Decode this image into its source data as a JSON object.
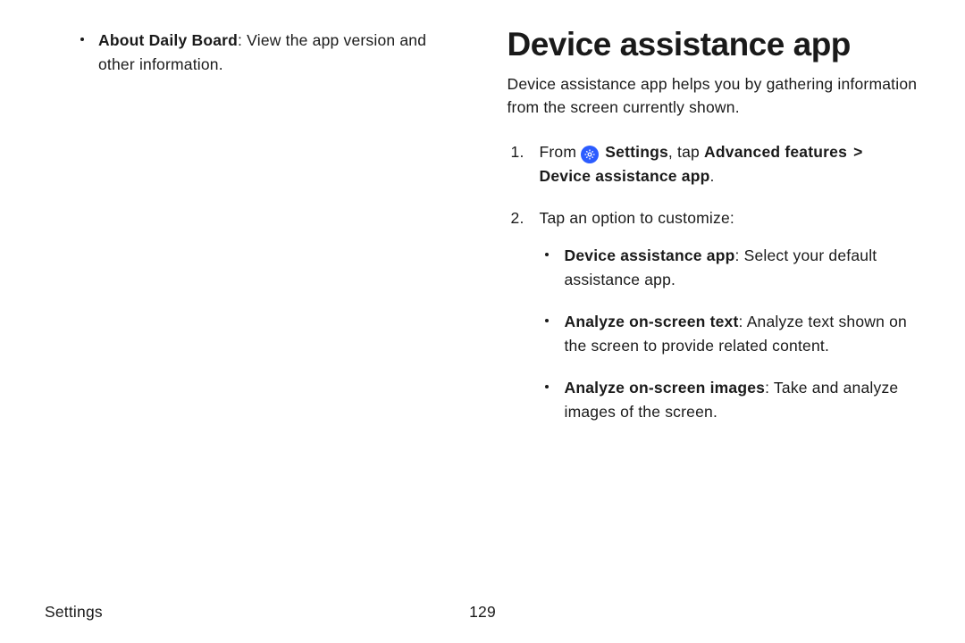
{
  "left": {
    "bullet_title": "About Daily Board",
    "bullet_body": ": View the app version and other information."
  },
  "right": {
    "heading": "Device assistance app",
    "intro": "Device assistance app helps you by gathering information from the screen currently shown.",
    "step1": {
      "from": "From ",
      "settings": "Settings",
      "tap_label": ", tap ",
      "adv": "Advanced features",
      "chev": " >",
      "line2": "Device assistance app",
      "dot": "."
    },
    "step2": {
      "lead": "Tap an option to customize:",
      "items": [
        {
          "title": "Device assistance app",
          "body": ": Select your default assistance app."
        },
        {
          "title": "Analyze on-screen text",
          "body": ": Analyze text shown on the screen to provide related content."
        },
        {
          "title": "Analyze on-screen images",
          "body": ": Take and analyze images of the screen."
        }
      ]
    }
  },
  "footer": {
    "section": "Settings",
    "page": "129"
  }
}
